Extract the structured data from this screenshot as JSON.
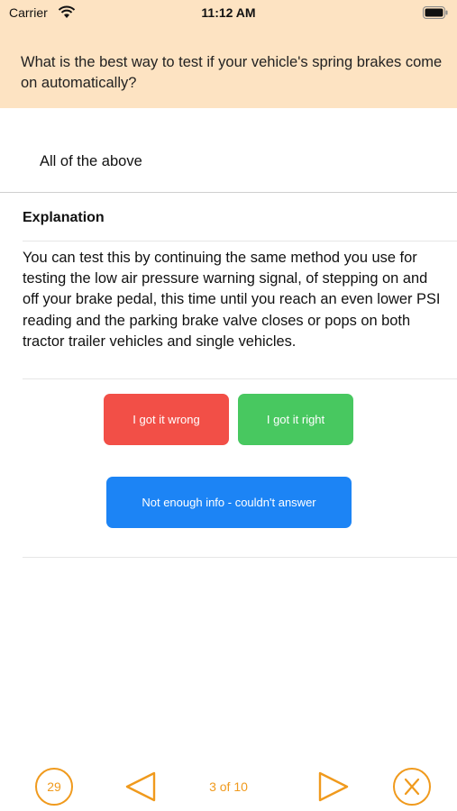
{
  "status_bar": {
    "carrier": "Carrier",
    "time": "11:12 AM",
    "icons": [
      "wifi-icon",
      "battery-icon"
    ]
  },
  "question": {
    "text": "What is the best way to test if your vehicle's spring brakes come on automatically?"
  },
  "answer": {
    "text": "All of the above"
  },
  "explanation": {
    "title": "Explanation",
    "body": "You can test this by continuing the same method you use for testing the low air pressure warning signal, of stepping on and off your brake pedal, this time until you reach an even lower PSI reading and the parking brake valve closes or pops on both tractor trailer vehicles and single vehicles."
  },
  "feedback_buttons": {
    "wrong_label": "I got it wrong",
    "right_label": "I got it right",
    "noinfo_label": "Not enough info - couldn't answer"
  },
  "bottom_nav": {
    "count": "29",
    "page_indicator": "3 of 10",
    "icons": [
      "previous-triangle-icon",
      "next-triangle-icon",
      "close-x-icon"
    ]
  },
  "colors": {
    "header_bg": "#fde3c2",
    "accent": "#f09a1d",
    "wrong": "#f24f47",
    "right": "#48c860",
    "noinfo": "#1c84f5"
  }
}
